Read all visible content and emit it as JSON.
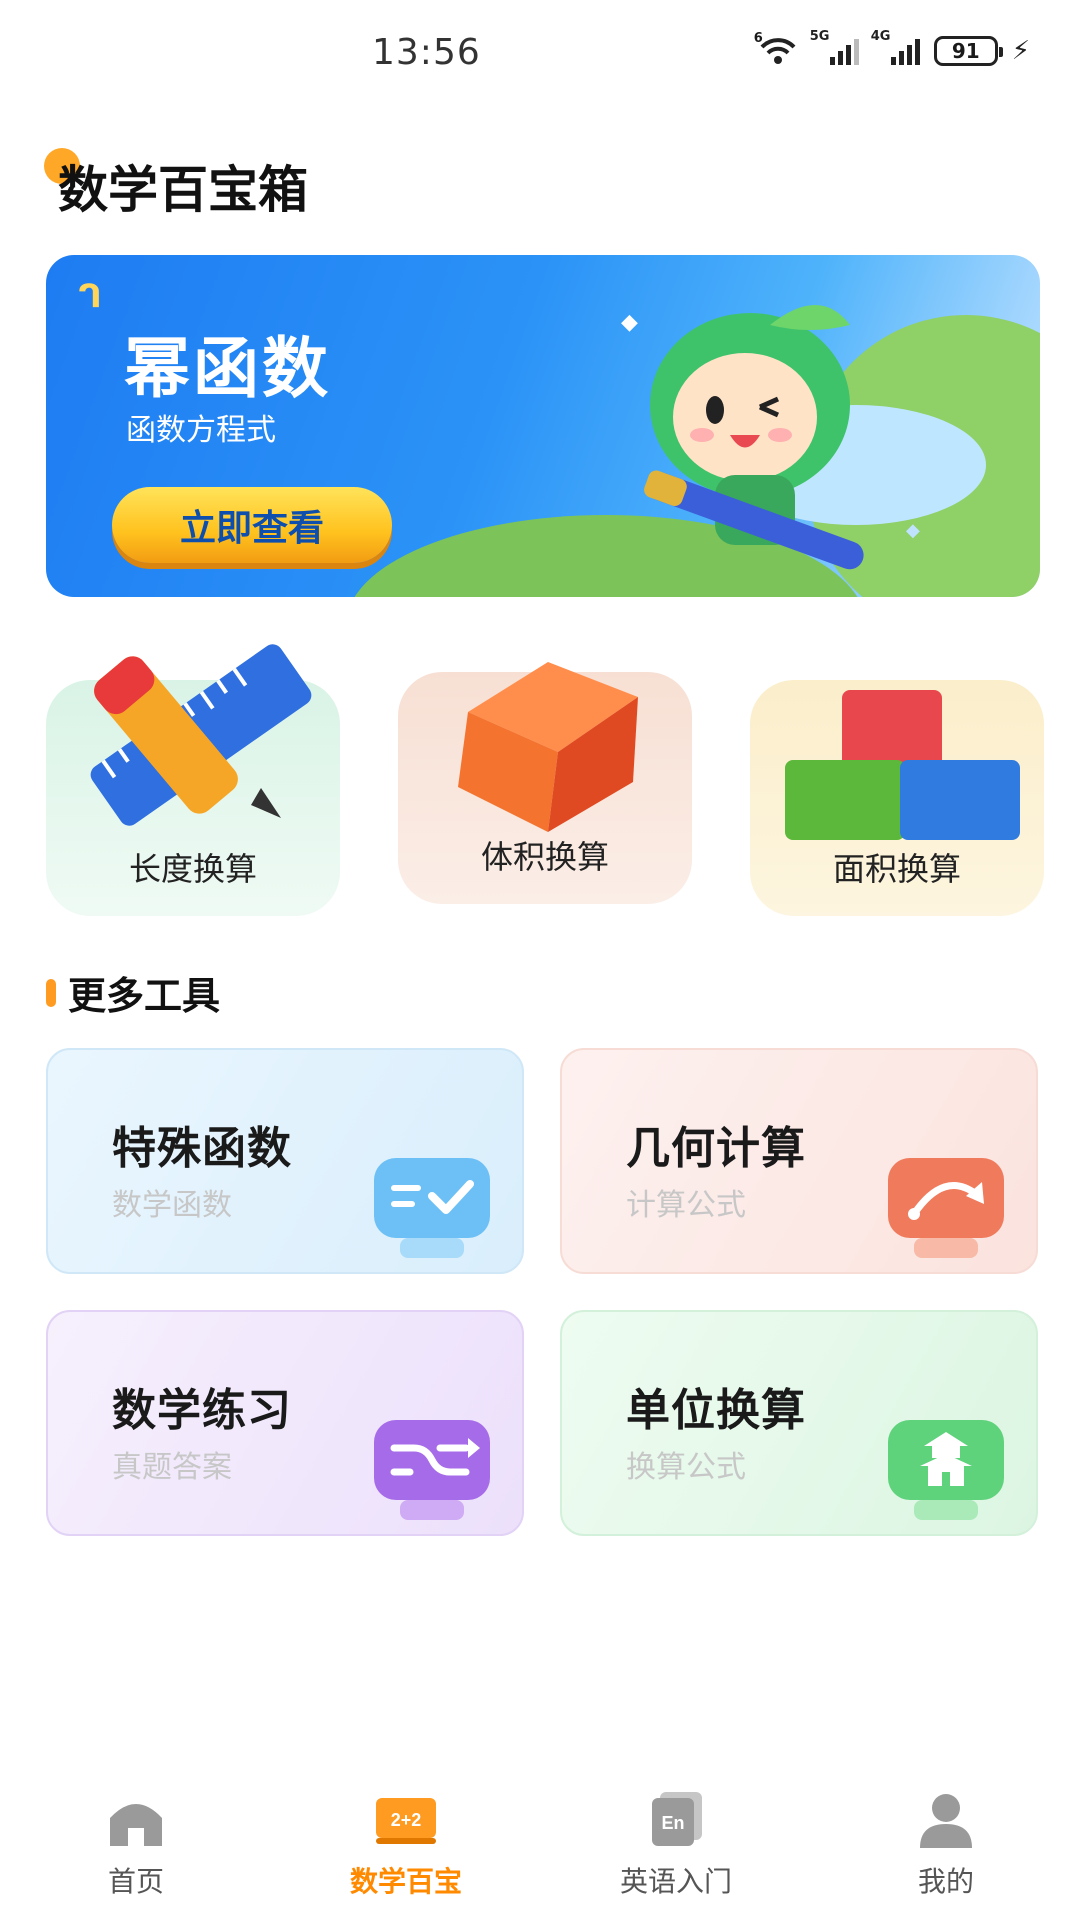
{
  "status_bar": {
    "time": "13:56",
    "battery": "91",
    "signal_1_label": "5G",
    "signal_2_label": "4G",
    "wifi_label": "6"
  },
  "page": {
    "title": "数学百宝箱"
  },
  "banner": {
    "title": "幂函数",
    "subtitle": "函数方程式",
    "button_label": "立即查看"
  },
  "categories": [
    {
      "label": "长度换算",
      "icon": "ruler-pencil-icon"
    },
    {
      "label": "体积换算",
      "icon": "cube-icon"
    },
    {
      "label": "面积换算",
      "icon": "blocks-icon"
    }
  ],
  "more_tools": {
    "section_title": "更多工具",
    "items": [
      {
        "title": "特殊函数",
        "subtitle": "数学函数",
        "icon": "check-chat-icon",
        "color": "#6cc0f5"
      },
      {
        "title": "几何计算",
        "subtitle": "计算公式",
        "icon": "curve-arrow-icon",
        "color": "#f07a5c"
      },
      {
        "title": "数学练习",
        "subtitle": "真题答案",
        "icon": "shuffle-icon",
        "color": "#a66be8"
      },
      {
        "title": "单位换算",
        "subtitle": "换算公式",
        "icon": "pagoda-icon",
        "color": "#5fd27c"
      }
    ]
  },
  "bottom_nav": {
    "items": [
      {
        "label": "首页",
        "icon": "home-icon"
      },
      {
        "label": "数学百宝",
        "icon": "math-board-icon",
        "badge": "2+2",
        "active": true
      },
      {
        "label": "英语入门",
        "icon": "english-book-icon",
        "badge": "En"
      },
      {
        "label": "我的",
        "icon": "profile-icon"
      }
    ]
  },
  "colors": {
    "accent": "#ff8a00",
    "banner_blue": "#1e7cf2",
    "button_yellow": "#ffc21e",
    "button_text": "#0e4fae"
  }
}
